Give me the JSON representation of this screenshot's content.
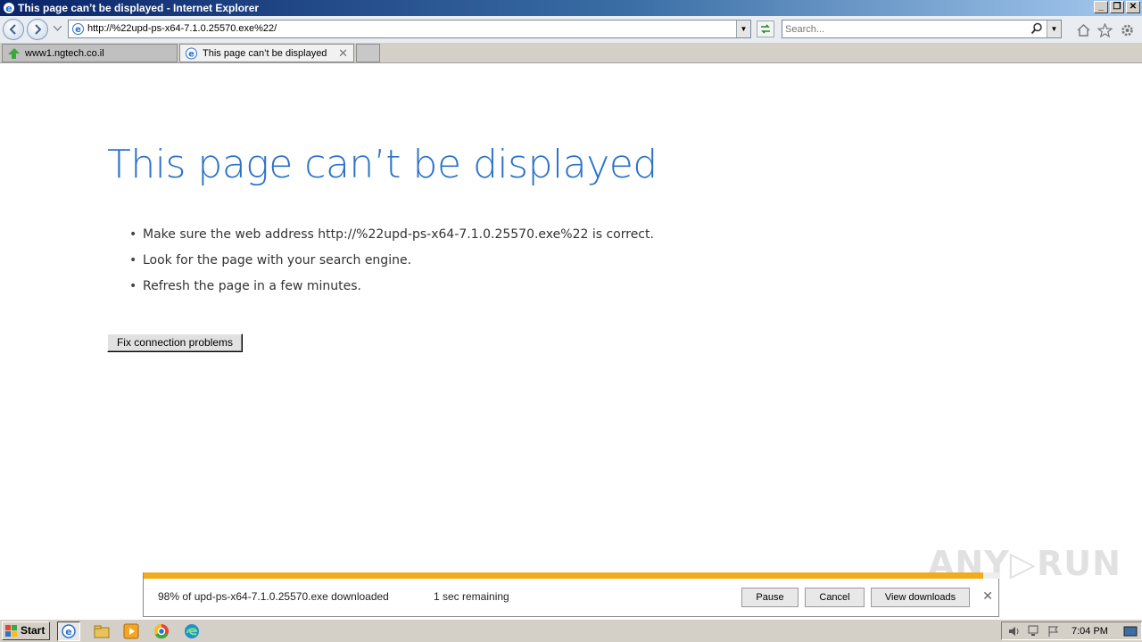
{
  "window": {
    "title": "This page can’t be displayed - Internet Explorer",
    "min_label": "_",
    "restore_label": "❐",
    "close_label": "✕"
  },
  "navbar": {
    "address": "http://%22upd-ps-x64-7.1.0.25570.exe%22/",
    "search_placeholder": "Search..."
  },
  "tabs": [
    {
      "label": "www1.ngtech.co.il"
    },
    {
      "label": "This page can’t be displayed",
      "close": "✕"
    }
  ],
  "error": {
    "title": "This page can’t be displayed",
    "bullets": [
      "Make sure the web address http://%22upd-ps-x64-7.1.0.25570.exe%22 is correct.",
      "Look for the page with your search engine.",
      "Refresh the page in a few minutes."
    ],
    "bullet_glyph": "•",
    "fix_button": "Fix connection problems"
  },
  "download": {
    "message": "98% of upd-ps-x64-7.1.0.25570.exe downloaded",
    "remaining": "1 sec remaining",
    "progress_fraction": 0.98,
    "pause": "Pause",
    "cancel": "Cancel",
    "view": "View downloads",
    "close": "✕"
  },
  "watermark": "ANY▷RUN",
  "taskbar": {
    "start": "Start",
    "clock": "7:04 PM"
  },
  "colors": {
    "title_blue": "#2b72c9",
    "progress": "#f0ac1c"
  }
}
